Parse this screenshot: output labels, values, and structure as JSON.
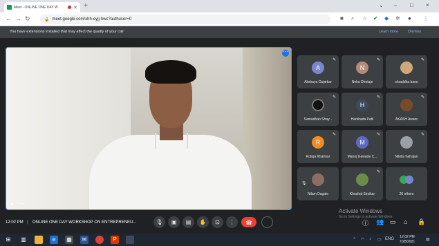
{
  "browser": {
    "tab_title": "Meet - ONLINE ONE DAY W",
    "new_tab_icon": "+",
    "url": "meet.google.com/xhh-eyjj-hwc?authuser=0",
    "window_controls": [
      "⌄",
      "–",
      "□",
      "×"
    ]
  },
  "warning": {
    "text": "You have extensions installed that may affect the quality of your call",
    "learn_more": "Learn more",
    "dismiss": "Dismiss"
  },
  "main_video": {
    "self_label": "You",
    "accent_color": "#4a8ff0"
  },
  "participants": [
    {
      "name": "Akshaya Gujarkar",
      "initial": "A",
      "color": "#7986cb"
    },
    {
      "name": "Neha Dhotaje",
      "initial": "N",
      "color": "#b48a78"
    },
    {
      "name": "shraddha bane",
      "initial": "",
      "color": "#cfa77a"
    },
    {
      "name": "Samadhan Shay...",
      "initial": "",
      "color": "#111111"
    },
    {
      "name": "Harshada Patil",
      "initial": "H",
      "color": "#3c4a5c"
    },
    {
      "name": "AKASH Aware",
      "initial": "",
      "color": "#7a4b2a"
    },
    {
      "name": "Rutuja Khairnar",
      "initial": "R",
      "color": "#f28b22"
    },
    {
      "name": "Manoj Gawade C...",
      "initial": "M",
      "color": "#5c6bc0"
    },
    {
      "name": "Nikita mahajan",
      "initial": "",
      "color": "#9aa0a6"
    },
    {
      "name": "Nilam Dagale",
      "initial": "",
      "color": "#8d6e63"
    },
    {
      "name": "Khushal Sirsikar",
      "initial": "",
      "color": "#6d8b4a"
    },
    {
      "name": "26 others",
      "initial": "",
      "color": "#34a853"
    }
  ],
  "bottom_bar": {
    "time": "12:02 PM",
    "separator": "|",
    "meeting_title": "ONLINE ONE DAY WORKSHOP ON ENTREPRENEU...",
    "watermark_line1": "Activate Windows",
    "watermark_line2": "Go to Settings to activate Windows."
  },
  "taskbar": {
    "clock_time": "12:02 PM",
    "clock_date": "7/28/2021",
    "language": "ENG"
  },
  "colors": {
    "end_call": "#ea4335",
    "meet_bg": "#202124"
  }
}
